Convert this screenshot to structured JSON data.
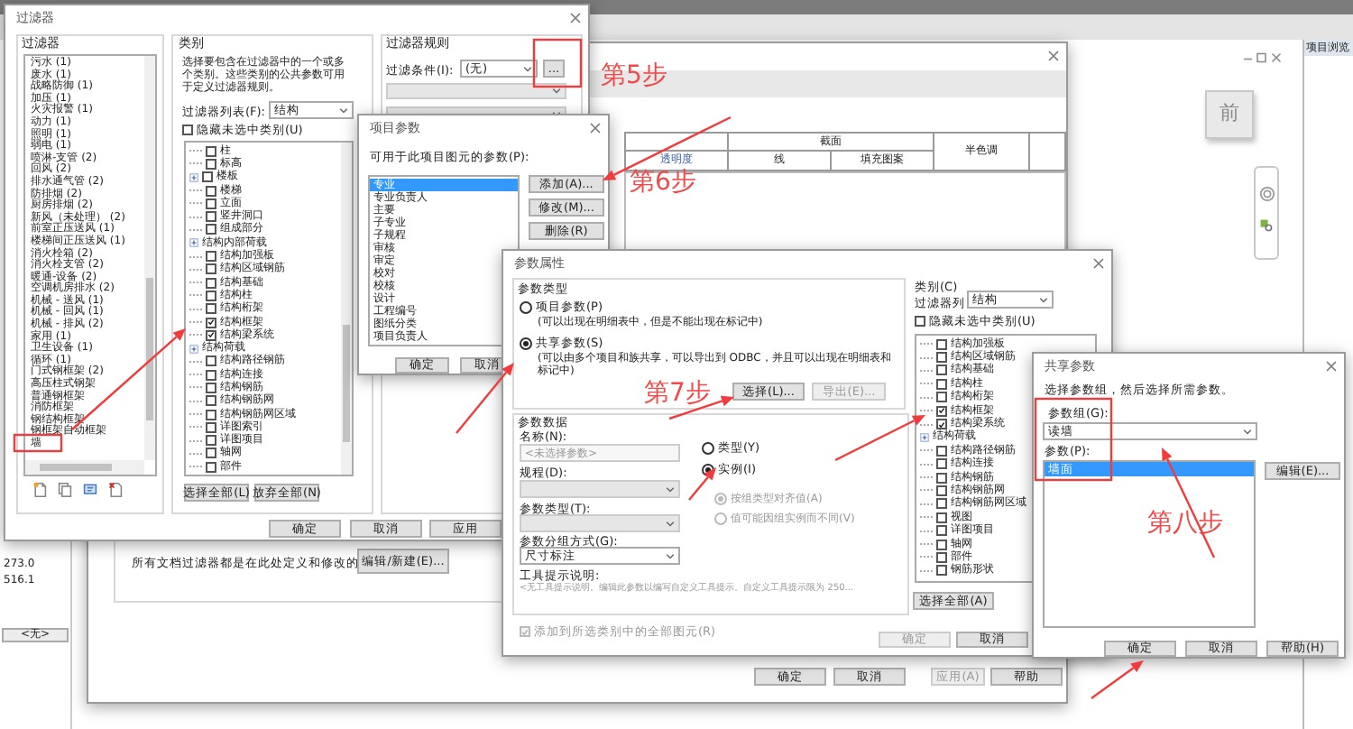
{
  "app": {
    "browser_title": "项目浏览",
    "view_cube_face": "前",
    "properties_values": [
      "273.0",
      "516.1"
    ],
    "properties_button": "<无>"
  },
  "visibility_dialog": {
    "table": {
      "group_header": "截面",
      "halftone_header": "半色调",
      "first_header": "透明度",
      "subheaders": [
        "线",
        "填充图案"
      ]
    },
    "filters_note": "所有文档过滤器都是在此处定义和修改的",
    "edit_button": "编辑/新建(E)...",
    "buttons": [
      {
        "label": "确定",
        "disabled": false
      },
      {
        "label": "取消",
        "disabled": false
      },
      {
        "label": "应用(A)",
        "disabled": true
      },
      {
        "label": "帮助",
        "disabled": false
      }
    ]
  },
  "filter_dialog": {
    "title": "过滤器",
    "filters": {
      "label": "过滤器",
      "items": [
        "污水 (1)",
        "废水 (1)",
        "战略防御 (1)",
        "加压 (1)",
        "火灾报警 (1)",
        "动力 (1)",
        "照明 (1)",
        "弱电 (1)",
        "喷淋-支管 (2)",
        "回风 (2)",
        "排水通气管 (2)",
        "防排烟 (2)",
        "厨房排烟 (2)",
        "新风（未处理） (2)",
        "前室正压送风 (1)",
        "楼梯间正压送风 (1)",
        "消火栓箱 (2)",
        "消火栓支管 (2)",
        "暖通-设备 (2)",
        "空调机房排水 (2)",
        "机械 - 送风 (1)",
        "机械 - 回风 (1)",
        "机械 - 排风 (2)",
        "家用 (1)",
        "卫生设备 (1)",
        "循环 (1)",
        "门式钢框架 (2)",
        "高压柱式钢架",
        "普通钢框架",
        "消防框架",
        "钢结构框架",
        "钢框架自动框架",
        "墙"
      ]
    },
    "categories": {
      "label": "类别",
      "description": "选择要包含在过滤器中的一个或多个类别。这些类别的公共参数可用于定义过滤器规则。",
      "filter_list_label": "过滤器列表(F):",
      "filter_list_value": "结构",
      "hide_unchecked": {
        "label": "隐藏未选中类别(U)",
        "checked": false
      },
      "items": [
        {
          "kind": "item",
          "label": "柱",
          "checked": false
        },
        {
          "kind": "item",
          "label": "标高",
          "checked": false
        },
        {
          "kind": "expandable",
          "label": "楼板",
          "checked": false
        },
        {
          "kind": "item",
          "label": "楼梯",
          "checked": false
        },
        {
          "kind": "item",
          "label": "立面",
          "checked": false
        },
        {
          "kind": "item",
          "label": "竖井洞口",
          "checked": false
        },
        {
          "kind": "item",
          "label": "组成部分",
          "checked": false
        },
        {
          "kind": "group",
          "label": "结构内部荷载"
        },
        {
          "kind": "item",
          "label": "结构加强板",
          "checked": false
        },
        {
          "kind": "item",
          "label": "结构区域钢筋",
          "checked": false
        },
        {
          "kind": "item",
          "label": "结构基础",
          "checked": false
        },
        {
          "kind": "item",
          "label": "结构柱",
          "checked": false
        },
        {
          "kind": "item",
          "label": "结构桁架",
          "checked": false
        },
        {
          "kind": "item",
          "label": "结构框架",
          "checked": true
        },
        {
          "kind": "item",
          "label": "结构梁系统",
          "checked": true
        },
        {
          "kind": "group",
          "label": "结构荷载"
        },
        {
          "kind": "item",
          "label": "结构路径钢筋",
          "checked": false
        },
        {
          "kind": "item",
          "label": "结构连接",
          "checked": false
        },
        {
          "kind": "item",
          "label": "结构钢筋",
          "checked": false
        },
        {
          "kind": "item",
          "label": "结构钢筋网",
          "checked": false
        },
        {
          "kind": "item",
          "label": "结构钢筋网区域",
          "checked": false
        },
        {
          "kind": "item",
          "label": "详图索引",
          "checked": false
        },
        {
          "kind": "item",
          "label": "详图项目",
          "checked": false
        },
        {
          "kind": "item",
          "label": "轴网",
          "checked": false
        },
        {
          "kind": "item",
          "label": "部件",
          "checked": false
        }
      ],
      "buttons": [
        "选择全部(L)",
        "放弃全部(N)"
      ]
    },
    "rules": {
      "label": "过滤器规则",
      "condition_label": "过滤条件(I):",
      "condition_value": "(无)",
      "browse_button": "..."
    },
    "buttons": [
      "确定",
      "取消",
      "应用"
    ]
  },
  "project_parameters": {
    "title": "项目参数",
    "list_label": "可用于此项目图元的参数(P):",
    "items": [
      {
        "label": "专业",
        "selected": true
      },
      {
        "label": "专业负责人",
        "selected": false
      },
      {
        "label": "主要",
        "selected": false
      },
      {
        "label": "子专业",
        "selected": false
      },
      {
        "label": "子规程",
        "selected": false
      },
      {
        "label": "审核",
        "selected": false
      },
      {
        "label": "审定",
        "selected": false
      },
      {
        "label": "校对",
        "selected": false
      },
      {
        "label": "校核",
        "selected": false
      },
      {
        "label": "设计",
        "selected": false
      },
      {
        "label": "工程编号",
        "selected": false
      },
      {
        "label": "图纸分类",
        "selected": false
      },
      {
        "label": "项目负责人",
        "selected": false
      }
    ],
    "side_buttons": [
      "添加(A)...",
      "修改(M)...",
      "删除(R)"
    ],
    "buttons": [
      "确定",
      "取消"
    ]
  },
  "parameter_properties": {
    "title": "参数属性",
    "type_label": "参数类型",
    "types": [
      {
        "label": "项目参数(P)",
        "note": "(可以出现在明细表中，但是不能出现在标记中)",
        "selected": false
      },
      {
        "label": "共享参数(S)",
        "note": "(可以由多个项目和族共享，可以导出到 ODBC，并且可以出现在明细表和标记中)",
        "selected": true
      }
    ],
    "select_button": "选择(L)...",
    "export_button": "导出(E)...",
    "data_label": "参数数据",
    "name_label": "名称(N):",
    "name_placeholder": "<未选择参数>",
    "discipline_label": "规程(D):",
    "param_type_label": "参数类型(T):",
    "group_label": "参数分组方式(G):",
    "group_value": "尺寸标注",
    "tooltip_label": "工具提示说明:",
    "tooltip_text": "<无工具提示说明。编辑此参数以编写自定义工具提示。自定义工具提示限为 250...",
    "scope": [
      {
        "label": "类型(Y)",
        "selected": false
      },
      {
        "label": "实例(I)",
        "selected": true
      }
    ],
    "instance_options": [
      {
        "label": "按组类型对齐值(A)",
        "selected": true
      },
      {
        "label": "值可能因组实例而不同(V)",
        "selected": false
      }
    ],
    "add_all": {
      "label": "添加到所选类别中的全部图元(R)",
      "checked": true
    },
    "categories_label": "类别(C)",
    "filter_list_label": "过滤器列",
    "filter_list_value": "结构",
    "hide_unchecked": {
      "label": "隐藏未选中类别(U)",
      "checked": false
    },
    "items": [
      {
        "kind": "item",
        "label": "结构加强板",
        "checked": false
      },
      {
        "kind": "item",
        "label": "结构区域钢筋",
        "checked": false
      },
      {
        "kind": "item",
        "label": "结构基础",
        "checked": false
      },
      {
        "kind": "item",
        "label": "结构柱",
        "checked": false
      },
      {
        "kind": "item",
        "label": "结构桁架",
        "checked": false
      },
      {
        "kind": "item",
        "label": "结构框架",
        "checked": true
      },
      {
        "kind": "item",
        "label": "结构梁系统",
        "checked": true
      },
      {
        "kind": "group",
        "label": "结构荷载"
      },
      {
        "kind": "item",
        "label": "结构路径钢筋",
        "checked": false
      },
      {
        "kind": "item",
        "label": "结构连接",
        "checked": false
      },
      {
        "kind": "item",
        "label": "结构钢筋",
        "checked": false
      },
      {
        "kind": "item",
        "label": "结构钢筋网",
        "checked": false
      },
      {
        "kind": "item",
        "label": "结构钢筋网区域",
        "checked": false
      },
      {
        "kind": "item",
        "label": "视图",
        "checked": false
      },
      {
        "kind": "item",
        "label": "详图项目",
        "checked": false
      },
      {
        "kind": "item",
        "label": "轴网",
        "checked": false
      },
      {
        "kind": "item",
        "label": "部件",
        "checked": false
      },
      {
        "kind": "item",
        "label": "钢筋形状",
        "checked": false
      }
    ],
    "select_all_button": "选择全部(A)",
    "buttons": [
      {
        "label": "确定",
        "disabled": true
      },
      {
        "label": "取消",
        "disabled": false
      }
    ]
  },
  "shared_parameters": {
    "title": "共享参数",
    "instruction": "选择参数组，然后选择所需参数。",
    "group_label": "参数组(G):",
    "group_value": "读墙",
    "params_label": "参数(P):",
    "items": [
      {
        "label": "墙面",
        "selected": true
      }
    ],
    "edit_button": "编辑(E)...",
    "buttons": [
      "确定",
      "取消",
      "帮助(H)"
    ]
  },
  "annotations": {
    "steps": [
      "第5步",
      "第6步",
      "第7步",
      "第八步"
    ]
  }
}
